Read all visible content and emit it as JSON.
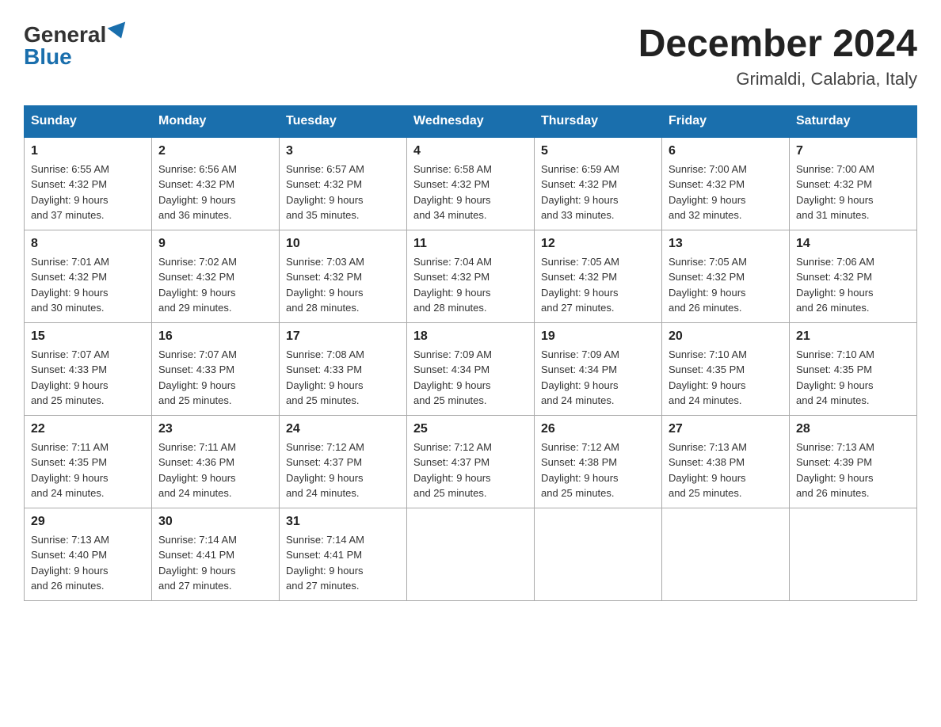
{
  "logo": {
    "general": "General",
    "blue": "Blue"
  },
  "title": {
    "month_year": "December 2024",
    "location": "Grimaldi, Calabria, Italy"
  },
  "weekdays": [
    "Sunday",
    "Monday",
    "Tuesday",
    "Wednesday",
    "Thursday",
    "Friday",
    "Saturday"
  ],
  "weeks": [
    [
      {
        "day": "1",
        "sunrise": "6:55 AM",
        "sunset": "4:32 PM",
        "daylight": "9 hours and 37 minutes."
      },
      {
        "day": "2",
        "sunrise": "6:56 AM",
        "sunset": "4:32 PM",
        "daylight": "9 hours and 36 minutes."
      },
      {
        "day": "3",
        "sunrise": "6:57 AM",
        "sunset": "4:32 PM",
        "daylight": "9 hours and 35 minutes."
      },
      {
        "day": "4",
        "sunrise": "6:58 AM",
        "sunset": "4:32 PM",
        "daylight": "9 hours and 34 minutes."
      },
      {
        "day": "5",
        "sunrise": "6:59 AM",
        "sunset": "4:32 PM",
        "daylight": "9 hours and 33 minutes."
      },
      {
        "day": "6",
        "sunrise": "7:00 AM",
        "sunset": "4:32 PM",
        "daylight": "9 hours and 32 minutes."
      },
      {
        "day": "7",
        "sunrise": "7:00 AM",
        "sunset": "4:32 PM",
        "daylight": "9 hours and 31 minutes."
      }
    ],
    [
      {
        "day": "8",
        "sunrise": "7:01 AM",
        "sunset": "4:32 PM",
        "daylight": "9 hours and 30 minutes."
      },
      {
        "day": "9",
        "sunrise": "7:02 AM",
        "sunset": "4:32 PM",
        "daylight": "9 hours and 29 minutes."
      },
      {
        "day": "10",
        "sunrise": "7:03 AM",
        "sunset": "4:32 PM",
        "daylight": "9 hours and 28 minutes."
      },
      {
        "day": "11",
        "sunrise": "7:04 AM",
        "sunset": "4:32 PM",
        "daylight": "9 hours and 28 minutes."
      },
      {
        "day": "12",
        "sunrise": "7:05 AM",
        "sunset": "4:32 PM",
        "daylight": "9 hours and 27 minutes."
      },
      {
        "day": "13",
        "sunrise": "7:05 AM",
        "sunset": "4:32 PM",
        "daylight": "9 hours and 26 minutes."
      },
      {
        "day": "14",
        "sunrise": "7:06 AM",
        "sunset": "4:32 PM",
        "daylight": "9 hours and 26 minutes."
      }
    ],
    [
      {
        "day": "15",
        "sunrise": "7:07 AM",
        "sunset": "4:33 PM",
        "daylight": "9 hours and 25 minutes."
      },
      {
        "day": "16",
        "sunrise": "7:07 AM",
        "sunset": "4:33 PM",
        "daylight": "9 hours and 25 minutes."
      },
      {
        "day": "17",
        "sunrise": "7:08 AM",
        "sunset": "4:33 PM",
        "daylight": "9 hours and 25 minutes."
      },
      {
        "day": "18",
        "sunrise": "7:09 AM",
        "sunset": "4:34 PM",
        "daylight": "9 hours and 25 minutes."
      },
      {
        "day": "19",
        "sunrise": "7:09 AM",
        "sunset": "4:34 PM",
        "daylight": "9 hours and 24 minutes."
      },
      {
        "day": "20",
        "sunrise": "7:10 AM",
        "sunset": "4:35 PM",
        "daylight": "9 hours and 24 minutes."
      },
      {
        "day": "21",
        "sunrise": "7:10 AM",
        "sunset": "4:35 PM",
        "daylight": "9 hours and 24 minutes."
      }
    ],
    [
      {
        "day": "22",
        "sunrise": "7:11 AM",
        "sunset": "4:35 PM",
        "daylight": "9 hours and 24 minutes."
      },
      {
        "day": "23",
        "sunrise": "7:11 AM",
        "sunset": "4:36 PM",
        "daylight": "9 hours and 24 minutes."
      },
      {
        "day": "24",
        "sunrise": "7:12 AM",
        "sunset": "4:37 PM",
        "daylight": "9 hours and 24 minutes."
      },
      {
        "day": "25",
        "sunrise": "7:12 AM",
        "sunset": "4:37 PM",
        "daylight": "9 hours and 25 minutes."
      },
      {
        "day": "26",
        "sunrise": "7:12 AM",
        "sunset": "4:38 PM",
        "daylight": "9 hours and 25 minutes."
      },
      {
        "day": "27",
        "sunrise": "7:13 AM",
        "sunset": "4:38 PM",
        "daylight": "9 hours and 25 minutes."
      },
      {
        "day": "28",
        "sunrise": "7:13 AM",
        "sunset": "4:39 PM",
        "daylight": "9 hours and 26 minutes."
      }
    ],
    [
      {
        "day": "29",
        "sunrise": "7:13 AM",
        "sunset": "4:40 PM",
        "daylight": "9 hours and 26 minutes."
      },
      {
        "day": "30",
        "sunrise": "7:14 AM",
        "sunset": "4:41 PM",
        "daylight": "9 hours and 27 minutes."
      },
      {
        "day": "31",
        "sunrise": "7:14 AM",
        "sunset": "4:41 PM",
        "daylight": "9 hours and 27 minutes."
      },
      null,
      null,
      null,
      null
    ]
  ],
  "labels": {
    "sunrise": "Sunrise:",
    "sunset": "Sunset:",
    "daylight": "Daylight:"
  }
}
